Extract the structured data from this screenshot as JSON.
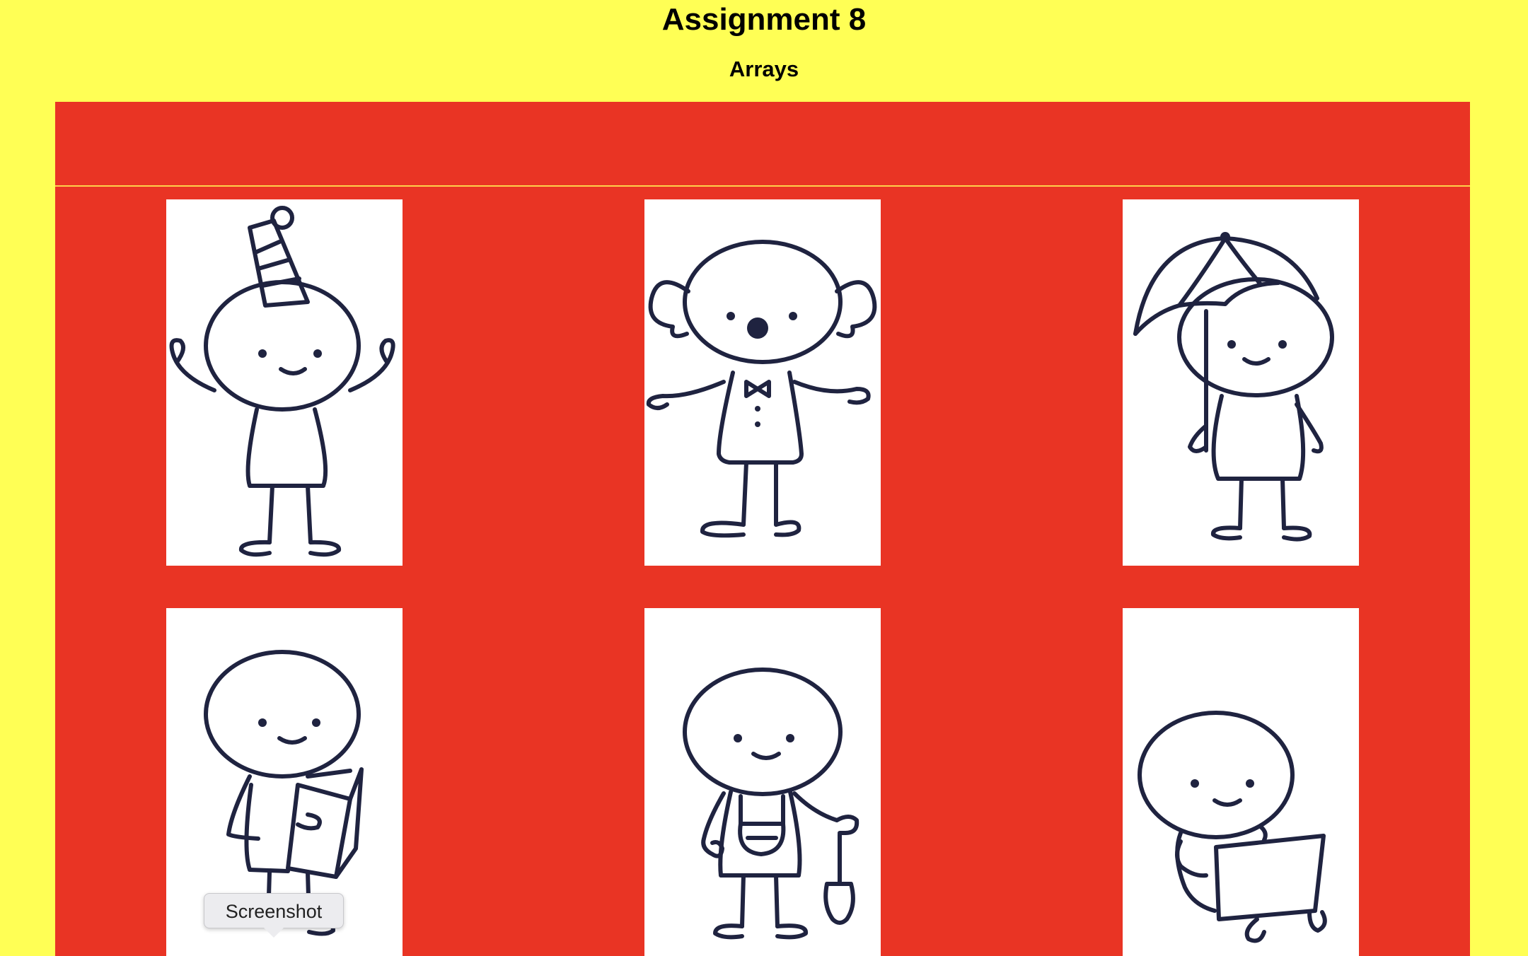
{
  "header": {
    "title": "Assignment 8",
    "subtitle": "Arrays"
  },
  "colors": {
    "background": "#ffff55",
    "panel": "#e93424",
    "card": "#ffffff",
    "ink": "#1f2340"
  },
  "gallery": {
    "images": [
      {
        "name": "party-hat-figure-image",
        "icon": "stick-figure-party-hat"
      },
      {
        "name": "clown-figure-image",
        "icon": "stick-figure-clown"
      },
      {
        "name": "umbrella-figure-image",
        "icon": "stick-figure-umbrella"
      },
      {
        "name": "book-reader-figure-image",
        "icon": "stick-figure-book"
      },
      {
        "name": "gardener-figure-image",
        "icon": "stick-figure-shovel"
      },
      {
        "name": "laptop-figure-image",
        "icon": "stick-figure-laptop"
      }
    ]
  },
  "tooltip": {
    "label": "Screenshot"
  }
}
